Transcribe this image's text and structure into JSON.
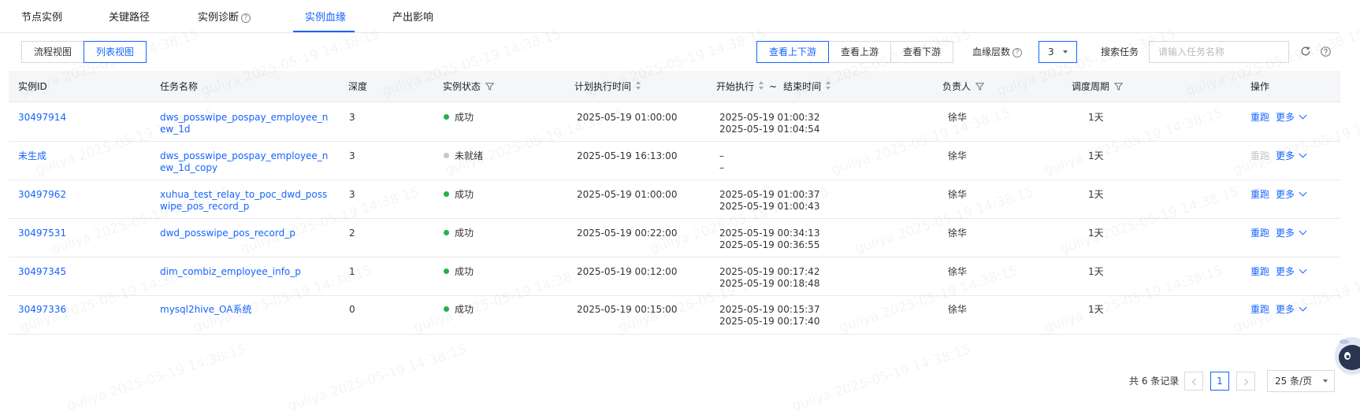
{
  "tabs": [
    {
      "label": "节点实例"
    },
    {
      "label": "关键路径"
    },
    {
      "label": "实例诊断"
    },
    {
      "label": "实例血缘"
    },
    {
      "label": "产出影响"
    }
  ],
  "view_toggle": {
    "flow": "流程视图",
    "list": "列表视图"
  },
  "direction": {
    "both": "查看上下游",
    "up": "查看上游",
    "down": "查看下游"
  },
  "lineage_depth": {
    "label": "血缘层数",
    "value": "3"
  },
  "search": {
    "label": "搜索任务",
    "placeholder": "请输入任务名称"
  },
  "icons": {
    "help": "help-icon",
    "refresh": "refresh-icon",
    "question": "question-icon",
    "filter": "filter-icon",
    "sort": "sort-icon",
    "chevron": "chevron-down-icon"
  },
  "table": {
    "headers": {
      "id": "实例ID",
      "name": "任务名称",
      "depth": "深度",
      "status": "实例状态",
      "plan_time": "计划执行时间",
      "start": "开始执行",
      "tilde": "~",
      "end": "结束时间",
      "owner": "负责人",
      "cycle": "调度周期",
      "ops": "操作"
    },
    "rows": [
      {
        "id": "30497914",
        "name": "dws_posswipe_pospay_employee_new_1d",
        "depth": "3",
        "status": "成功",
        "status_color": "#22b34a",
        "plan": "2025-05-19 01:00:00",
        "start": "2025-05-19 01:00:32",
        "end": "2025-05-19 01:04:54",
        "owner": "徐华",
        "cycle": "1天",
        "rerun": "重跑",
        "more": "更多",
        "rerun_enabled": true
      },
      {
        "id": "未生成",
        "name": "dws_posswipe_pospay_employee_new_1d_copy",
        "depth": "3",
        "status": "未就绪",
        "status_color": "#c4c6cc",
        "plan": "2025-05-19 16:13:00",
        "start": "–",
        "end": "–",
        "owner": "徐华",
        "cycle": "1天",
        "rerun": "重跑",
        "more": "更多",
        "rerun_enabled": false
      },
      {
        "id": "30497962",
        "name": "xuhua_test_relay_to_poc_dwd_posswipe_pos_record_p",
        "depth": "3",
        "status": "成功",
        "status_color": "#22b34a",
        "plan": "2025-05-19 01:00:00",
        "start": "2025-05-19 01:00:37",
        "end": "2025-05-19 01:00:43",
        "owner": "徐华",
        "cycle": "1天",
        "rerun": "重跑",
        "more": "更多",
        "rerun_enabled": true
      },
      {
        "id": "30497531",
        "name": "dwd_posswipe_pos_record_p",
        "depth": "2",
        "status": "成功",
        "status_color": "#22b34a",
        "plan": "2025-05-19 00:22:00",
        "start": "2025-05-19 00:34:13",
        "end": "2025-05-19 00:36:55",
        "owner": "徐华",
        "cycle": "1天",
        "rerun": "重跑",
        "more": "更多",
        "rerun_enabled": true
      },
      {
        "id": "30497345",
        "name": "dim_combiz_employee_info_p",
        "depth": "1",
        "status": "成功",
        "status_color": "#22b34a",
        "plan": "2025-05-19 00:12:00",
        "start": "2025-05-19 00:17:42",
        "end": "2025-05-19 00:18:48",
        "owner": "徐华",
        "cycle": "1天",
        "rerun": "重跑",
        "more": "更多",
        "rerun_enabled": true
      },
      {
        "id": "30497336",
        "name": "mysql2hive_OA系统",
        "depth": "0",
        "status": "成功",
        "status_color": "#22b34a",
        "plan": "2025-05-19 00:15:00",
        "start": "2025-05-19 00:15:37",
        "end": "2025-05-19 00:17:40",
        "owner": "徐华",
        "cycle": "1天",
        "rerun": "重跑",
        "more": "更多",
        "rerun_enabled": true
      }
    ]
  },
  "pagination": {
    "total": "共 6 条记录",
    "current": "1",
    "page_size": "25 条/页"
  },
  "watermark": "guliya 2025-05-19 14:38:15",
  "colors": {
    "primary": "#1664ff",
    "success": "#22b34a",
    "not_ready": "#c4c6cc",
    "header_bg": "#f4f6f8"
  }
}
